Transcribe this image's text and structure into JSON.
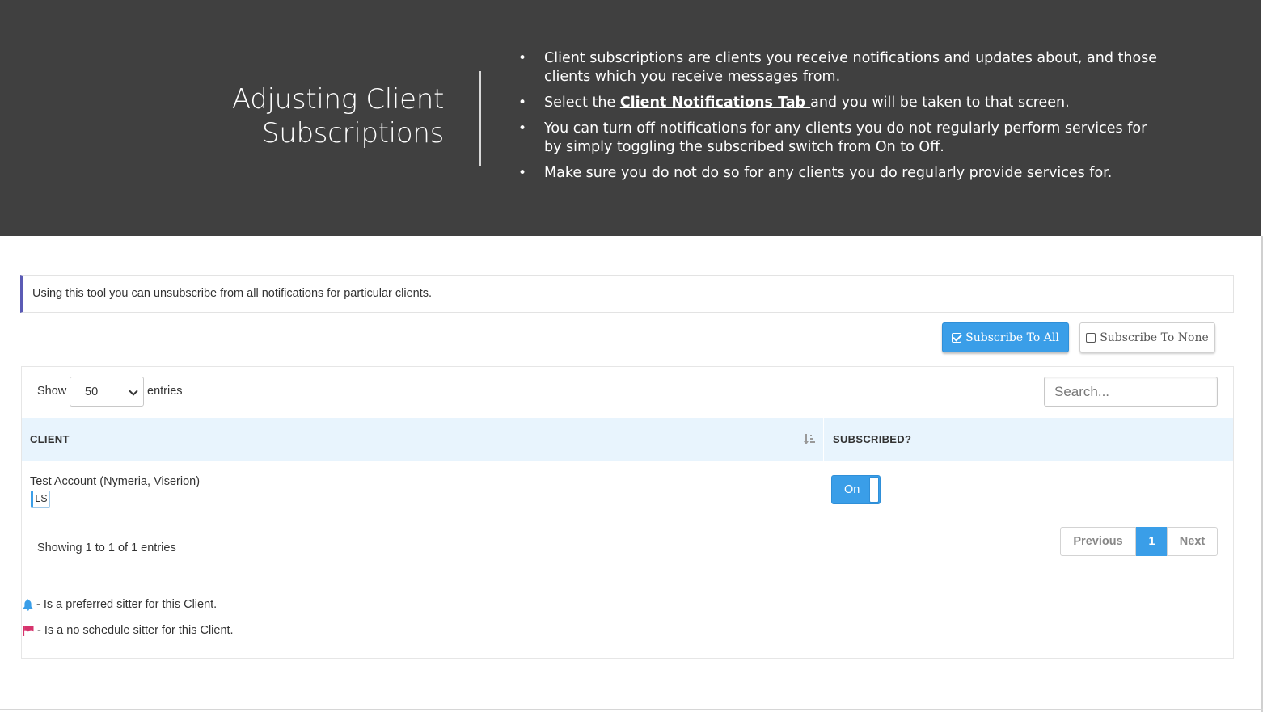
{
  "slide": {
    "title_line1": "Adjusting Client",
    "title_line2": "Subscriptions",
    "bullets": [
      "Client subscriptions are clients you receive notifications and updates about, and those clients which you receive messages from.",
      {
        "before": "Select the ",
        "link": "Client Notifications Tab ",
        "after": "and you will be taken to that screen."
      },
      "You can turn off notifications for any clients you do not regularly perform services for by simply toggling the subscribed switch from On to Off.",
      "Make sure you do not do so for any clients you do regularly provide services for."
    ]
  },
  "info_text": "Using this tool you can unsubscribe from all notifications for particular clients.",
  "actions": {
    "subscribe_all": "Subscribe To All",
    "subscribe_none": "Subscribe To None"
  },
  "table_controls": {
    "show_label": "Show",
    "page_size": "50",
    "entries_label": "entries",
    "search_placeholder": "Search..."
  },
  "table": {
    "columns": [
      "CLIENT",
      "SUBSCRIBED?"
    ],
    "rows": [
      {
        "client": "Test Account (Nymeria, Viserion)",
        "badge": "LS",
        "subscribed": "On"
      }
    ]
  },
  "footer": {
    "showing": "Showing 1 to 1 of 1 entries",
    "pagination": {
      "previous": "Previous",
      "current": "1",
      "next": "Next"
    }
  },
  "legend": [
    {
      "icon": "bell-icon",
      "text": "- Is a preferred sitter for this Client.",
      "color": "#3a9ee8"
    },
    {
      "icon": "flag-icon",
      "text": "- Is a no schedule sitter for this Client.",
      "color": "#d6336c"
    }
  ],
  "colors": {
    "header_bg": "#404040",
    "accent": "#3a9ee8",
    "table_header_bg": "#e8f4fd"
  }
}
